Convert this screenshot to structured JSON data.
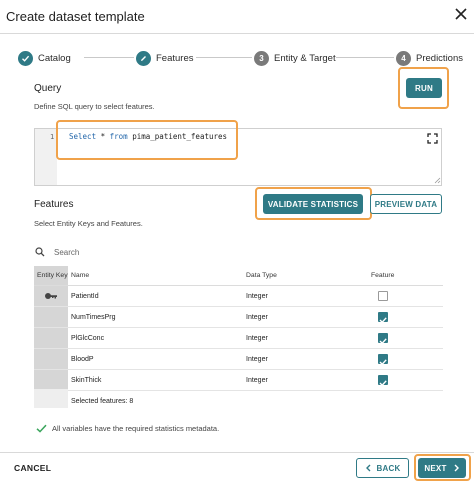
{
  "dialog": {
    "title": "Create dataset template"
  },
  "stepper": {
    "steps": [
      {
        "label": "Catalog",
        "number": "",
        "state": "done"
      },
      {
        "label": "Features",
        "number": "",
        "state": "active"
      },
      {
        "label": "Entity & Target",
        "number": "3",
        "state": "pending"
      },
      {
        "label": "Predictions",
        "number": "4",
        "state": "pending"
      }
    ]
  },
  "query": {
    "title": "Query",
    "subtitle": "Define SQL query to select features.",
    "run_label": "RUN",
    "line_number": "1",
    "code_keyword1": "Select",
    "code_mid": " * ",
    "code_keyword2": "from",
    "code_rest": " pima_patient_features"
  },
  "features": {
    "title": "Features",
    "subtitle": "Select Entity Keys and Features.",
    "validate_label": "VALIDATE STATISTICS",
    "preview_label": "PREVIEW DATA",
    "search_placeholder": "Search",
    "columns": [
      "Entity Key",
      "Name",
      "Data Type",
      "Feature"
    ],
    "rows": [
      {
        "name": "PatientId",
        "type": "Integer",
        "entity_key": true,
        "feature": false
      },
      {
        "name": "NumTimesPrg",
        "type": "Integer",
        "entity_key": false,
        "feature": true
      },
      {
        "name": "PlGlcConc",
        "type": "Integer",
        "entity_key": false,
        "feature": true
      },
      {
        "name": "BloodP",
        "type": "Integer",
        "entity_key": false,
        "feature": true
      },
      {
        "name": "SkinThick",
        "type": "Integer",
        "entity_key": false,
        "feature": true
      }
    ],
    "selected_text": "Selected features: 8",
    "status_message": "All variables have the required statistics metadata."
  },
  "footer": {
    "cancel_label": "CANCEL",
    "back_label": "BACK",
    "next_label": "NEXT"
  },
  "colors": {
    "accent": "#2f7a86",
    "highlight": "#f0a24a"
  }
}
